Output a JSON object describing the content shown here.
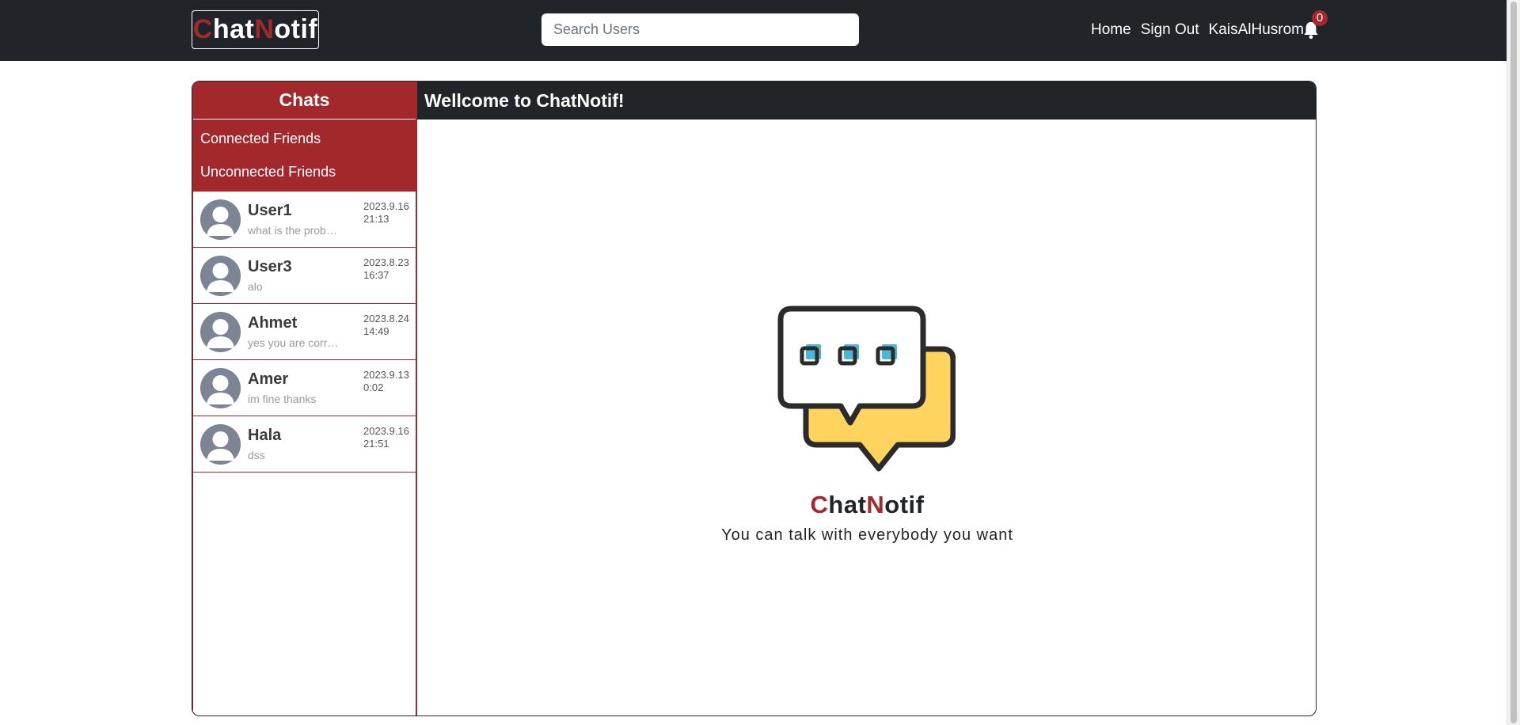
{
  "navbar": {
    "brand": {
      "c": "C",
      "hat": "hat",
      "n": "N",
      "otif": "otif"
    },
    "search_placeholder": "Search Users",
    "links": {
      "home": "Home",
      "sign_out": "Sign Out",
      "user": "KaisAlHusrom"
    },
    "notification_count": "0"
  },
  "sidebar": {
    "title": "Chats",
    "menu": {
      "connected": "Connected Friends",
      "unconnected": "Unconnected Friends"
    },
    "chats": [
      {
        "name": "User1",
        "message": "what is the problem",
        "date": "2023.9.16",
        "time": "21:13"
      },
      {
        "name": "User3",
        "message": "alo",
        "date": "2023.8.23",
        "time": "16:37"
      },
      {
        "name": "Ahmet",
        "message": "yes you are correct",
        "date": "2023.8.24",
        "time": "14:49"
      },
      {
        "name": "Amer",
        "message": "im fine thanks",
        "date": "2023.9.13",
        "time": "0:02"
      },
      {
        "name": "Hala",
        "message": "dss",
        "date": "2023.9.16",
        "time": "21:51"
      }
    ]
  },
  "content": {
    "title": "Wellcome to ChatNotif!",
    "hero": {
      "c": "C",
      "hat": "hat",
      "n": "N",
      "otif": "otif",
      "subtitle": "You can talk with everybody you want"
    }
  },
  "colors": {
    "brand_red": "#a3282c",
    "dark": "#212529",
    "bubble_yellow": "#fed45f",
    "dot_blue": "#4cb6d6"
  }
}
